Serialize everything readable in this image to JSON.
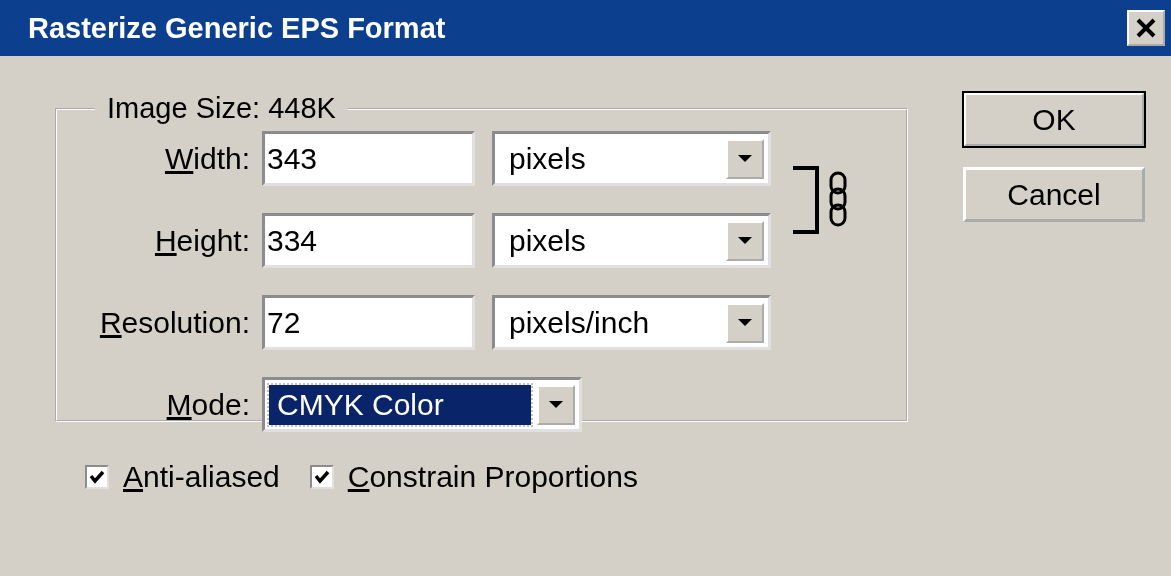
{
  "window": {
    "title": "Rasterize Generic EPS Format"
  },
  "group": {
    "legend": "Image Size: 448K"
  },
  "fields": [
    {
      "key": "W",
      "label": "idth:",
      "value": "343",
      "unit": "pixels"
    },
    {
      "key": "H",
      "label": "eight:",
      "value": "334",
      "unit": "pixels"
    },
    {
      "key": "R",
      "label": "esolution:",
      "value": "72",
      "unit": "pixels/inch"
    }
  ],
  "link": {
    "linked": true
  },
  "mode": {
    "key": "M",
    "label": "ode:",
    "value": "CMYK Color",
    "focused": true
  },
  "checkboxes": [
    {
      "key": "A",
      "label": "nti-aliased",
      "checked": true
    },
    {
      "key": "C",
      "label": "onstrain Proportions",
      "checked": true
    }
  ],
  "buttons": [
    {
      "label": "OK",
      "default": true
    },
    {
      "label": "Cancel",
      "default": false
    }
  ]
}
